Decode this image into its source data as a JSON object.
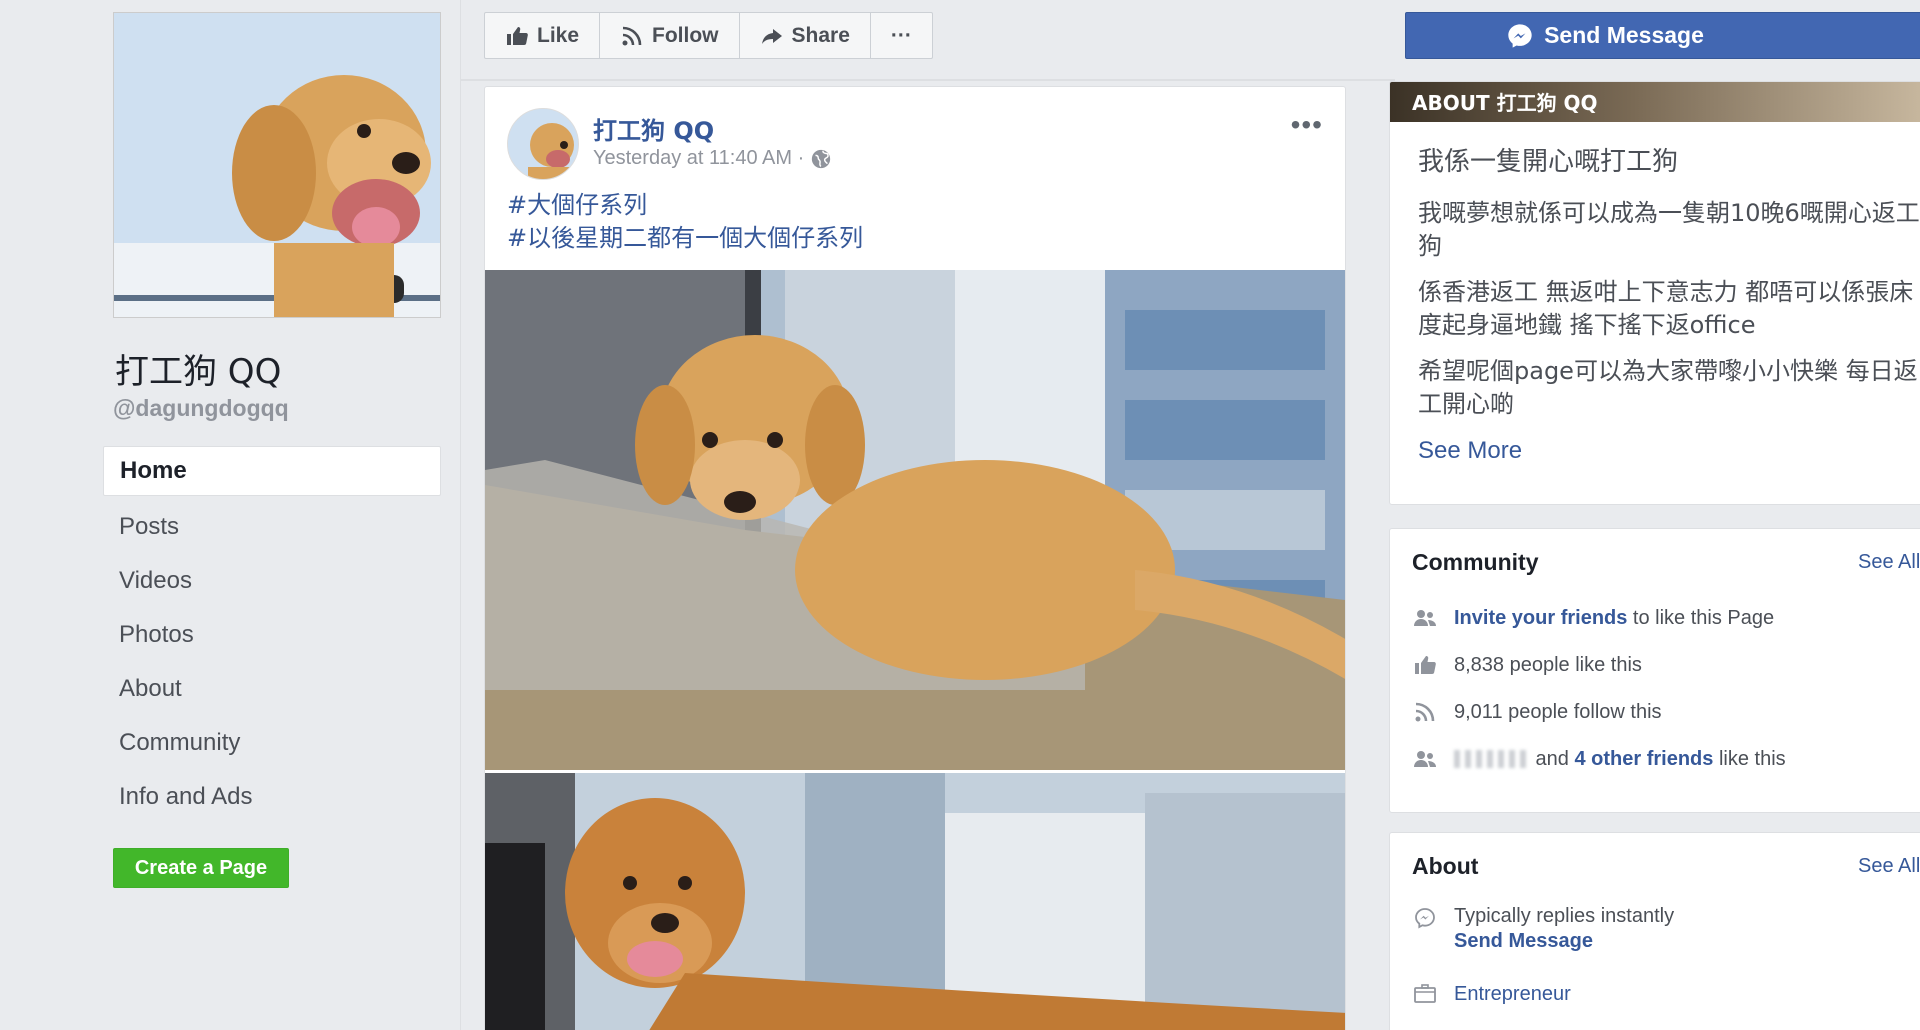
{
  "sidebar": {
    "page_name": "打工狗 QQ",
    "handle": "@dagungdogqq",
    "nav": [
      {
        "label": "Home",
        "active": true
      },
      {
        "label": "Posts"
      },
      {
        "label": "Videos"
      },
      {
        "label": "Photos"
      },
      {
        "label": "About"
      },
      {
        "label": "Community"
      },
      {
        "label": "Info and Ads"
      }
    ],
    "create_page": "Create a Page"
  },
  "actions": {
    "like": "Like",
    "follow": "Follow",
    "share": "Share",
    "more": "···"
  },
  "post": {
    "author": "打工狗 QQ",
    "time": "Yesterday at 11:40 AM ·",
    "menu": "•••",
    "hashtags": [
      "#大個仔系列",
      "#以後星期二都有一個大個仔系列"
    ]
  },
  "right": {
    "send_message": "Send Message",
    "about_header": "ABOUT 打工狗 QQ",
    "about_paragraphs": [
      "我係一隻開心嘅打工狗",
      "我嘅夢想就係可以成為一隻朝10晚6嘅開心返工狗",
      "係香港返工 無返咁上下意志力 都唔可以係張床度起身逼地鐵 搖下搖下返office",
      "希望呢個page可以為大家帶嚟小小快樂 每日返工開心啲"
    ],
    "see_more": "See More"
  },
  "community": {
    "title": "Community",
    "see_all": "See All",
    "invite_link": "Invite your friends",
    "invite_rest": " to like this Page",
    "likes": "8,838 people like this",
    "follows": "9,011 people follow this",
    "friends_and": " and ",
    "friends_link": "4 other friends",
    "friends_rest": " like this"
  },
  "about": {
    "title": "About",
    "see_all": "See All",
    "replies": "Typically replies instantly",
    "send_message": "Send Message",
    "category": "Entrepreneur"
  },
  "colors": {
    "fb_blue": "#4267b2",
    "link_blue": "#365899",
    "green": "#42b72a",
    "bg": "#e9ebee"
  }
}
